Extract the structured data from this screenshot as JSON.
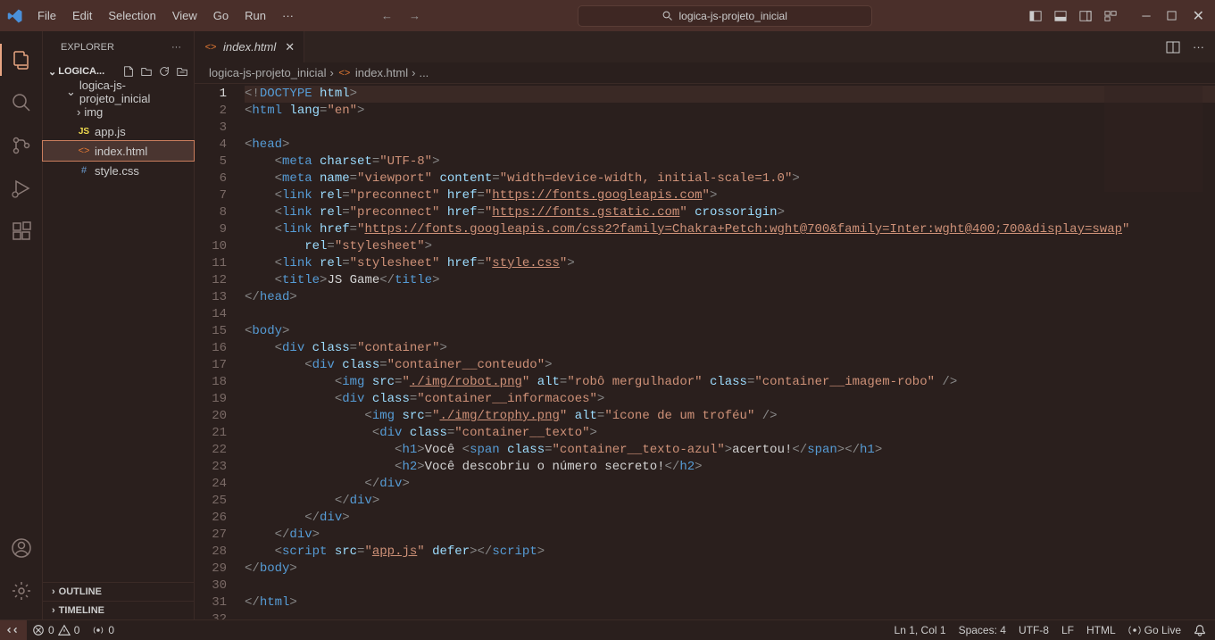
{
  "title": "logica-js-projeto_inicial",
  "menu": [
    "File",
    "Edit",
    "Selection",
    "View",
    "Go",
    "Run",
    "···"
  ],
  "sidebar": {
    "header": "EXPLORER",
    "folder": "LOGICA...",
    "root": "logica-js-projeto_inicial",
    "items": [
      {
        "name": "img",
        "type": "folder"
      },
      {
        "name": "app.js",
        "type": "js"
      },
      {
        "name": "index.html",
        "type": "html"
      },
      {
        "name": "style.css",
        "type": "css"
      }
    ],
    "outline": "OUTLINE",
    "timeline": "TIMELINE"
  },
  "tab": {
    "name": "index.html"
  },
  "breadcrumbs": [
    "logica-js-projeto_inicial",
    "index.html",
    "..."
  ],
  "statusbar": {
    "errors": "0",
    "warnings": "0",
    "ports": "0",
    "lncol": "Ln 1, Col 1",
    "spaces": "Spaces: 4",
    "encoding": "UTF-8",
    "eol": "LF",
    "lang": "HTML",
    "golive": "Go Live"
  },
  "code": {
    "lines": 32,
    "content": [
      [
        [
          "<!",
          "bracket"
        ],
        [
          "DOCTYPE",
          "doctype"
        ],
        [
          " html",
          "attr"
        ],
        [
          ">",
          "bracket"
        ]
      ],
      [
        [
          "<",
          "bracket"
        ],
        [
          "html",
          "tag"
        ],
        [
          " lang",
          "attr"
        ],
        [
          "=",
          "bracket"
        ],
        [
          "\"en\"",
          "string"
        ],
        [
          ">",
          "bracket"
        ]
      ],
      [],
      [
        [
          "<",
          "bracket"
        ],
        [
          "head",
          "tag"
        ],
        [
          ">",
          "bracket"
        ]
      ],
      [
        [
          "    <",
          "bracket"
        ],
        [
          "meta",
          "tag"
        ],
        [
          " charset",
          "attr"
        ],
        [
          "=",
          "bracket"
        ],
        [
          "\"UTF-8\"",
          "string"
        ],
        [
          ">",
          "bracket"
        ]
      ],
      [
        [
          "    <",
          "bracket"
        ],
        [
          "meta",
          "tag"
        ],
        [
          " name",
          "attr"
        ],
        [
          "=",
          "bracket"
        ],
        [
          "\"viewport\"",
          "string"
        ],
        [
          " content",
          "attr"
        ],
        [
          "=",
          "bracket"
        ],
        [
          "\"width=device-width, initial-scale=1.0\"",
          "string"
        ],
        [
          ">",
          "bracket"
        ]
      ],
      [
        [
          "    <",
          "bracket"
        ],
        [
          "link",
          "tag"
        ],
        [
          " rel",
          "attr"
        ],
        [
          "=",
          "bracket"
        ],
        [
          "\"preconnect\"",
          "string"
        ],
        [
          " href",
          "attr"
        ],
        [
          "=",
          "bracket"
        ],
        [
          "\"",
          "string"
        ],
        [
          "https://fonts.googleapis.com",
          "string-underline"
        ],
        [
          "\"",
          "string"
        ],
        [
          ">",
          "bracket"
        ]
      ],
      [
        [
          "    <",
          "bracket"
        ],
        [
          "link",
          "tag"
        ],
        [
          " rel",
          "attr"
        ],
        [
          "=",
          "bracket"
        ],
        [
          "\"preconnect\"",
          "string"
        ],
        [
          " href",
          "attr"
        ],
        [
          "=",
          "bracket"
        ],
        [
          "\"",
          "string"
        ],
        [
          "https://fonts.gstatic.com",
          "string-underline"
        ],
        [
          "\"",
          "string"
        ],
        [
          " crossorigin",
          "attr"
        ],
        [
          ">",
          "bracket"
        ]
      ],
      [
        [
          "    <",
          "bracket"
        ],
        [
          "link",
          "tag"
        ],
        [
          " href",
          "attr"
        ],
        [
          "=",
          "bracket"
        ],
        [
          "\"",
          "string"
        ],
        [
          "https://fonts.googleapis.com/css2?family=Chakra+Petch:wght@700&family=Inter:wght@400;700&display=swap",
          "string-underline"
        ],
        [
          "\"",
          "string"
        ]
      ],
      [
        [
          "        rel",
          "attr"
        ],
        [
          "=",
          "bracket"
        ],
        [
          "\"stylesheet\"",
          "string"
        ],
        [
          ">",
          "bracket"
        ]
      ],
      [
        [
          "    <",
          "bracket"
        ],
        [
          "link",
          "tag"
        ],
        [
          " rel",
          "attr"
        ],
        [
          "=",
          "bracket"
        ],
        [
          "\"stylesheet\"",
          "string"
        ],
        [
          " href",
          "attr"
        ],
        [
          "=",
          "bracket"
        ],
        [
          "\"",
          "string"
        ],
        [
          "style.css",
          "string-underline"
        ],
        [
          "\"",
          "string"
        ],
        [
          ">",
          "bracket"
        ]
      ],
      [
        [
          "    <",
          "bracket"
        ],
        [
          "title",
          "tag"
        ],
        [
          ">",
          "bracket"
        ],
        [
          "JS Game",
          "text"
        ],
        [
          "</",
          "bracket"
        ],
        [
          "title",
          "tag"
        ],
        [
          ">",
          "bracket"
        ]
      ],
      [
        [
          "</",
          "bracket"
        ],
        [
          "head",
          "tag"
        ],
        [
          ">",
          "bracket"
        ]
      ],
      [],
      [
        [
          "<",
          "bracket"
        ],
        [
          "body",
          "tag"
        ],
        [
          ">",
          "bracket"
        ]
      ],
      [
        [
          "    <",
          "bracket"
        ],
        [
          "div",
          "tag"
        ],
        [
          " class",
          "attr"
        ],
        [
          "=",
          "bracket"
        ],
        [
          "\"container\"",
          "string"
        ],
        [
          ">",
          "bracket"
        ]
      ],
      [
        [
          "        <",
          "bracket"
        ],
        [
          "div",
          "tag"
        ],
        [
          " class",
          "attr"
        ],
        [
          "=",
          "bracket"
        ],
        [
          "\"container__conteudo\"",
          "string"
        ],
        [
          ">",
          "bracket"
        ]
      ],
      [
        [
          "            <",
          "bracket"
        ],
        [
          "img",
          "tag"
        ],
        [
          " src",
          "attr"
        ],
        [
          "=",
          "bracket"
        ],
        [
          "\"",
          "string"
        ],
        [
          "./img/robot.png",
          "string-underline"
        ],
        [
          "\"",
          "string"
        ],
        [
          " alt",
          "attr"
        ],
        [
          "=",
          "bracket"
        ],
        [
          "\"robô mergulhador\"",
          "string"
        ],
        [
          " class",
          "attr"
        ],
        [
          "=",
          "bracket"
        ],
        [
          "\"container__imagem-robo\"",
          "string"
        ],
        [
          " />",
          "bracket"
        ]
      ],
      [
        [
          "            <",
          "bracket"
        ],
        [
          "div",
          "tag"
        ],
        [
          " class",
          "attr"
        ],
        [
          "=",
          "bracket"
        ],
        [
          "\"container__informacoes\"",
          "string"
        ],
        [
          ">",
          "bracket"
        ]
      ],
      [
        [
          "                <",
          "bracket"
        ],
        [
          "img",
          "tag"
        ],
        [
          " src",
          "attr"
        ],
        [
          "=",
          "bracket"
        ],
        [
          "\"",
          "string"
        ],
        [
          "./img/trophy.png",
          "string-underline"
        ],
        [
          "\"",
          "string"
        ],
        [
          " alt",
          "attr"
        ],
        [
          "=",
          "bracket"
        ],
        [
          "\"ícone de um troféu\"",
          "string"
        ],
        [
          " />",
          "bracket"
        ]
      ],
      [
        [
          "                 <",
          "bracket"
        ],
        [
          "div",
          "tag"
        ],
        [
          " class",
          "attr"
        ],
        [
          "=",
          "bracket"
        ],
        [
          "\"container__texto\"",
          "string"
        ],
        [
          ">",
          "bracket"
        ]
      ],
      [
        [
          "                    <",
          "bracket"
        ],
        [
          "h1",
          "tag"
        ],
        [
          ">",
          "bracket"
        ],
        [
          "Você ",
          "text"
        ],
        [
          "<",
          "bracket"
        ],
        [
          "span",
          "tag"
        ],
        [
          " class",
          "attr"
        ],
        [
          "=",
          "bracket"
        ],
        [
          "\"container__texto-azul\"",
          "string"
        ],
        [
          ">",
          "bracket"
        ],
        [
          "acertou!",
          "text"
        ],
        [
          "</",
          "bracket"
        ],
        [
          "span",
          "tag"
        ],
        [
          "></",
          "bracket"
        ],
        [
          "h1",
          "tag"
        ],
        [
          ">",
          "bracket"
        ]
      ],
      [
        [
          "                    <",
          "bracket"
        ],
        [
          "h2",
          "tag"
        ],
        [
          ">",
          "bracket"
        ],
        [
          "Você descobriu o número secreto!",
          "text"
        ],
        [
          "</",
          "bracket"
        ],
        [
          "h2",
          "tag"
        ],
        [
          ">",
          "bracket"
        ]
      ],
      [
        [
          "                </",
          "bracket"
        ],
        [
          "div",
          "tag"
        ],
        [
          ">",
          "bracket"
        ]
      ],
      [
        [
          "            </",
          "bracket"
        ],
        [
          "div",
          "tag"
        ],
        [
          ">",
          "bracket"
        ]
      ],
      [
        [
          "        </",
          "bracket"
        ],
        [
          "div",
          "tag"
        ],
        [
          ">",
          "bracket"
        ]
      ],
      [
        [
          "    </",
          "bracket"
        ],
        [
          "div",
          "tag"
        ],
        [
          ">",
          "bracket"
        ]
      ],
      [
        [
          "    <",
          "bracket"
        ],
        [
          "script",
          "tag"
        ],
        [
          " src",
          "attr"
        ],
        [
          "=",
          "bracket"
        ],
        [
          "\"",
          "string"
        ],
        [
          "app.js",
          "string-underline"
        ],
        [
          "\"",
          "string"
        ],
        [
          " defer",
          "attr"
        ],
        [
          "></",
          "bracket"
        ],
        [
          "script",
          "tag"
        ],
        [
          ">",
          "bracket"
        ]
      ],
      [
        [
          "</",
          "bracket"
        ],
        [
          "body",
          "tag"
        ],
        [
          ">",
          "bracket"
        ]
      ],
      [],
      [
        [
          "</",
          "bracket"
        ],
        [
          "html",
          "tag"
        ],
        [
          ">",
          "bracket"
        ]
      ],
      []
    ]
  }
}
